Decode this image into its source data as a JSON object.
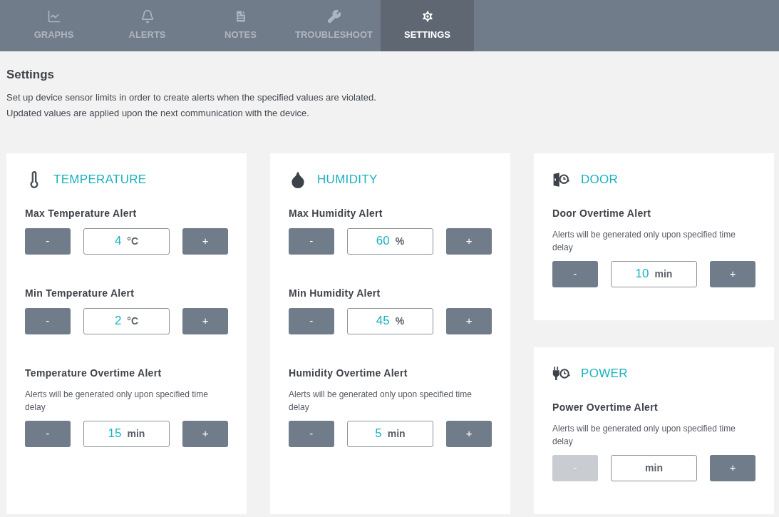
{
  "tabs": [
    {
      "label": "GRAPHS",
      "kind": "graph",
      "selected": false
    },
    {
      "label": "ALERTS",
      "kind": "bell",
      "selected": false
    },
    {
      "label": "NOTES",
      "kind": "note",
      "selected": false
    },
    {
      "label": "TROUBLESHOOT",
      "kind": "wrench",
      "selected": false
    },
    {
      "label": "SETTINGS",
      "kind": "gear",
      "selected": true
    }
  ],
  "page": {
    "title": "Settings",
    "description": [
      "Set up device sensor limits in order to create alerts when the specified values are violated.",
      "Updated values are applied upon the next communication with the device."
    ]
  },
  "columns": [
    {
      "cards": [
        {
          "kind": "thermometer",
          "title": "TEMPERATURE",
          "fields": [
            {
              "label": "Max Temperature Alert",
              "minus": "-",
              "value": "4",
              "unit": "°C",
              "plus": "+",
              "minus_disabled": false
            },
            {
              "label": "Min Temperature Alert",
              "minus": "-",
              "value": "2",
              "unit": "°C",
              "plus": "+",
              "minus_disabled": false
            },
            {
              "label": "Temperature Overtime Alert",
              "note": "Alerts will be generated only upon specified time delay",
              "minus": "-",
              "value": "15",
              "unit": "min",
              "plus": "+",
              "minus_disabled": false
            }
          ]
        }
      ]
    },
    {
      "cards": [
        {
          "kind": "droplet",
          "title": "HUMIDITY",
          "fields": [
            {
              "label": "Max Humidity Alert",
              "minus": "-",
              "value": "60",
              "unit": "%",
              "plus": "+",
              "minus_disabled": false
            },
            {
              "label": "Min Humidity Alert",
              "minus": "-",
              "value": "45",
              "unit": "%",
              "plus": "+",
              "minus_disabled": false
            },
            {
              "label": "Humidity Overtime Alert",
              "note": "Alerts will be generated only upon specified time delay",
              "minus": "-",
              "value": "5",
              "unit": "min",
              "plus": "+",
              "minus_disabled": false
            }
          ]
        }
      ]
    },
    {
      "cards": [
        {
          "kind": "door",
          "title": "DOOR",
          "fields": [
            {
              "label": "Door Overtime Alert",
              "note": "Alerts will be generated only upon specified time delay",
              "minus": "-",
              "value": "10",
              "unit": "min",
              "plus": "+",
              "minus_disabled": false
            }
          ]
        },
        {
          "kind": "plug",
          "title": "POWER",
          "fields": [
            {
              "label": "Power Overtime Alert",
              "note": "Alerts will be generated only upon specified time delay",
              "minus": "-",
              "unit": "min",
              "plus": "+",
              "minus_disabled": true
            }
          ]
        }
      ]
    }
  ]
}
